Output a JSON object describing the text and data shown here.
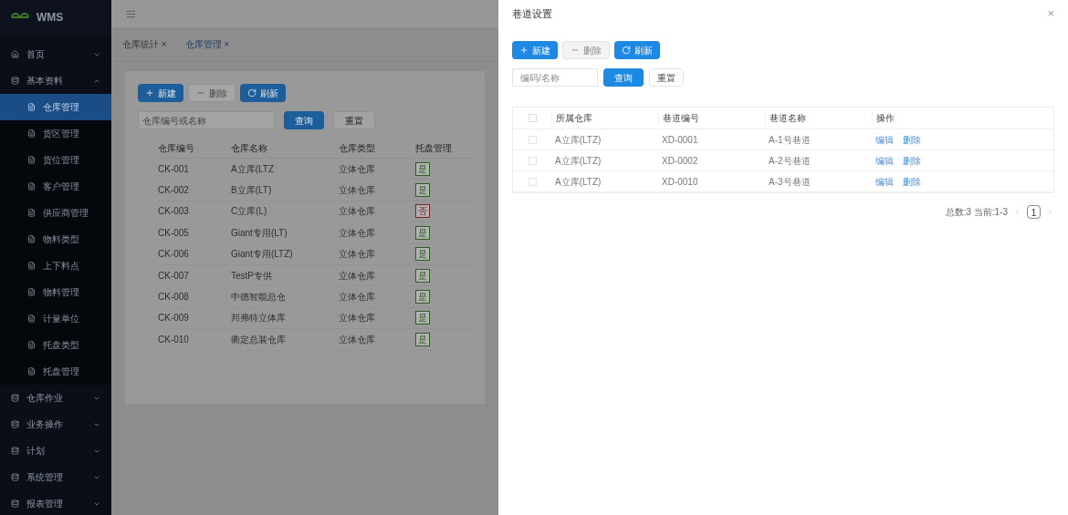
{
  "sidebar": {
    "logo": "WMS",
    "items": [
      {
        "label": "首页",
        "expanded": false
      },
      {
        "label": "基本资料",
        "expanded": true,
        "children": [
          {
            "label": "仓库管理",
            "selected": true
          },
          {
            "label": "货区管理",
            "selected": false
          },
          {
            "label": "货位管理",
            "selected": false
          },
          {
            "label": "客户管理",
            "selected": false
          },
          {
            "label": "供应商管理",
            "selected": false
          },
          {
            "label": "物料类型",
            "selected": false
          },
          {
            "label": "上下料点",
            "selected": false
          },
          {
            "label": "物料管理",
            "selected": false
          },
          {
            "label": "计量单位",
            "selected": false
          },
          {
            "label": "托盘类型",
            "selected": false
          },
          {
            "label": "托盘管理",
            "selected": false
          }
        ]
      },
      {
        "label": "仓库作业",
        "expanded": false
      },
      {
        "label": "业务操作",
        "expanded": false
      },
      {
        "label": "计划",
        "expanded": false
      },
      {
        "label": "系统管理",
        "expanded": false
      },
      {
        "label": "报表管理",
        "expanded": false
      }
    ]
  },
  "tabs": [
    {
      "label": "仓库统计",
      "close": "×",
      "selected": false
    },
    {
      "label": "仓库管理",
      "close": "×",
      "selected": true
    }
  ],
  "main": {
    "buttons": [
      {
        "label": "新建",
        "kind": "add",
        "disabled": false
      },
      {
        "label": "删除",
        "kind": "remove",
        "disabled": true
      },
      {
        "label": "刷新",
        "kind": "refresh",
        "disabled": false
      }
    ],
    "search": {
      "placeholder": "仓库编号或名称"
    },
    "query_button": "查询",
    "reset_button": "重置",
    "table": {
      "columns": [
        "仓库编号",
        "仓库名称",
        "仓库类型",
        "托盘管理"
      ],
      "rows": [
        {
          "code": "CK-001",
          "name": "A立库(LTZ",
          "type": "立体仓库",
          "tag": {
            "text": "是",
            "color": "#2f5e20"
          }
        },
        {
          "code": "CK-002",
          "name": "B立库(LT)",
          "type": "立体仓库",
          "tag": {
            "text": "是",
            "color": "#2f5e20"
          }
        },
        {
          "code": "CK-003",
          "name": "C立库(L)",
          "type": "立体仓库",
          "tag": {
            "text": "否",
            "color": "#7a2424"
          }
        },
        {
          "code": "CK-005",
          "name": "Giant专用(LT)",
          "type": "立体仓库",
          "tag": {
            "text": "是",
            "color": "#2f5e20"
          }
        },
        {
          "code": "CK-006",
          "name": "Giant专用(LTZ)",
          "type": "立体仓库",
          "tag": {
            "text": "是",
            "color": "#2f5e20"
          }
        },
        {
          "code": "CK-007",
          "name": "TestP专供",
          "type": "立体仓库",
          "tag": {
            "text": "是",
            "color": "#2f5e20"
          }
        },
        {
          "code": "CK-008",
          "name": "中德智能总仓",
          "type": "立体仓库",
          "tag": {
            "text": "是",
            "color": "#2f5e20"
          }
        },
        {
          "code": "CK-009",
          "name": "邦弗特立体库",
          "type": "立体仓库",
          "tag": {
            "text": "是",
            "color": "#2f5e20"
          }
        },
        {
          "code": "CK-010",
          "name": "衢定总装仓库",
          "type": "立体仓库",
          "tag": {
            "text": "是",
            "color": "#2f5e20"
          }
        }
      ]
    }
  },
  "drawer": {
    "title": "巷道设置",
    "close": "×",
    "buttons": [
      {
        "label": "新建",
        "kind": "add",
        "disabled": false
      },
      {
        "label": "删除",
        "kind": "remove",
        "disabled": true
      },
      {
        "label": "刷新",
        "kind": "refresh",
        "disabled": false
      }
    ],
    "search": {
      "placeholder": "编码/名称"
    },
    "query_button": "查询",
    "reset_button": "重置",
    "table": {
      "header_checked": false,
      "columns": [
        "所属仓库",
        "巷道编号",
        "巷道名称",
        "操作"
      ],
      "rows": [
        {
          "checked": false,
          "warehouse": "A立库(LTZ)",
          "code": "XD-0001",
          "name": "A-1号巷道",
          "actions": [
            "编辑",
            "删除"
          ]
        },
        {
          "checked": false,
          "warehouse": "A立库(LTZ)",
          "code": "XD-0002",
          "name": "A-2号巷道",
          "actions": [
            "编辑",
            "删除"
          ]
        },
        {
          "checked": false,
          "warehouse": "A立库(LTZ)",
          "code": "XD-0010",
          "name": "A-3号巷道",
          "actions": [
            "编辑",
            "删除"
          ]
        }
      ]
    },
    "pagination": {
      "summary": "总数:3 当前:1-3",
      "pages": [
        {
          "label": "1",
          "selected": true
        }
      ]
    }
  }
}
